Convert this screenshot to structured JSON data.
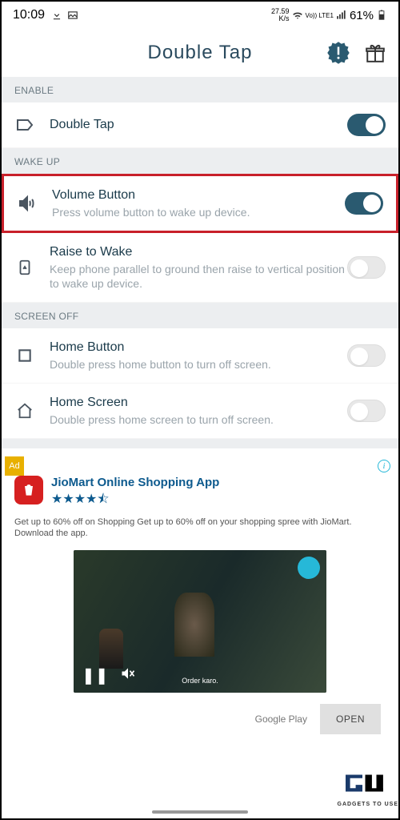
{
  "status": {
    "time": "10:09",
    "speed_top": "27.59",
    "speed_bottom": "K/s",
    "net": "Vo)) LTE1",
    "battery": "61%"
  },
  "header": {
    "title": "Double Tap"
  },
  "sections": {
    "enable": "ENABLE",
    "wakeup": "WAKE UP",
    "screenoff": "SCREEN OFF"
  },
  "rows": {
    "double_tap": {
      "title": "Double Tap"
    },
    "volume_button": {
      "title": "Volume Button",
      "subtitle": "Press volume button to wake up device."
    },
    "raise_wake": {
      "title": "Raise to Wake",
      "subtitle": "Keep phone parallel to ground then raise to vertical position to wake up device."
    },
    "home_button": {
      "title": "Home Button",
      "subtitle": "Double press home button to turn off screen."
    },
    "home_screen": {
      "title": "Home Screen",
      "subtitle": "Double press home screen to turn off screen."
    }
  },
  "ad": {
    "label": "Ad",
    "app_title": "JioMart Online Shopping App",
    "stars": "★★★★⯪",
    "desc": "Get up to 60% off on Shopping Get up to 60% off on your shopping spree with JioMart. Download the app.",
    "caption": "Order karo.",
    "source": "Google Play",
    "cta": "OPEN"
  },
  "watermark": "GADGETS TO USE"
}
